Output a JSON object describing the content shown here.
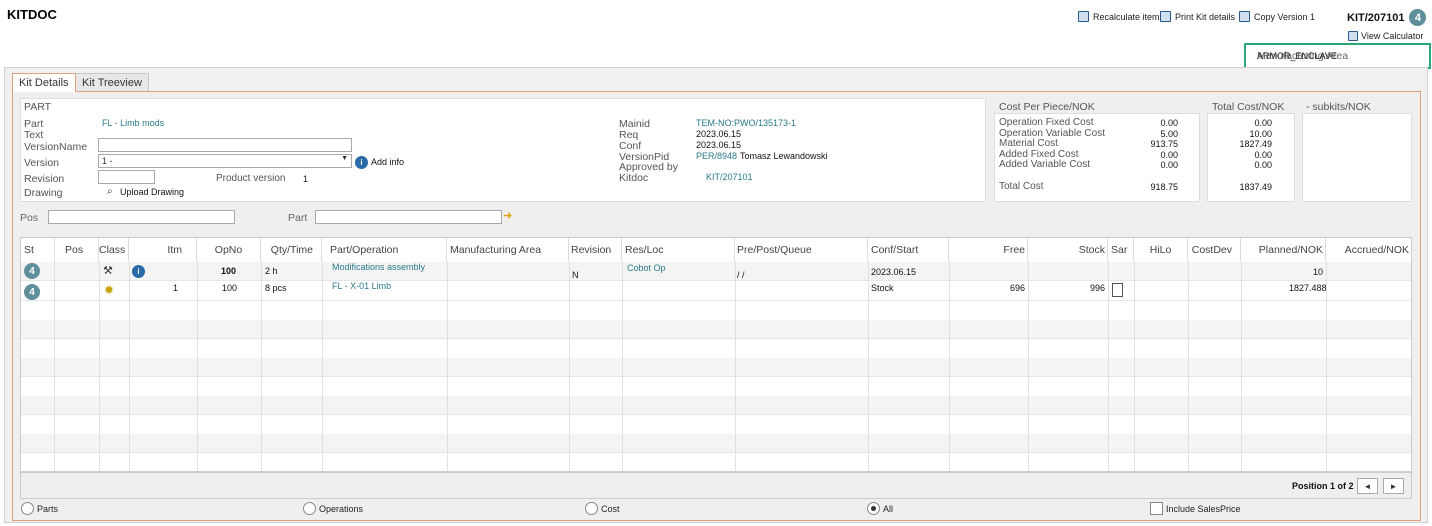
{
  "app_title": "KITDOC",
  "toolbar": {
    "recalculate": "Recalculate item",
    "print": "Print Kit details",
    "copy": "Copy Version 1",
    "kit_id": "KIT/207101",
    "kit_badge": "4",
    "view_calc": "View Calculator"
  },
  "mfg_area": {
    "label": "Manufacturing Area",
    "value": "ARMOR_ENCLAVE"
  },
  "tabs": [
    "Kit Details",
    "Kit Treeview"
  ],
  "part": {
    "header": "PART",
    "labels": {
      "part": "Part",
      "text": "Text",
      "versionname": "VersionName",
      "version": "Version",
      "revision": "Revision",
      "drawing": "Drawing"
    },
    "part_value": "FL - Limb mods",
    "version_value": "1 -",
    "add_info": "Add info",
    "product_version_label": "Product version",
    "product_version_value": "1",
    "upload_drawing": "Upload Drawing",
    "right_labels": {
      "mainid": "Mainid",
      "req": "Req",
      "conf": "Conf",
      "versionpid": "VersionPid",
      "approved": "Approved by",
      "kitdoc": "Kitdoc"
    },
    "mainid": "TEM-NO:PWO/135173-1",
    "req": "2023.06.15",
    "conf": "2023.06.15",
    "versionpid": "PER/8948",
    "versionpid_name": "Tomasz Lewandowski",
    "kitdoc": "KIT/207101"
  },
  "cost_per_piece": {
    "header": "Cost Per Piece/NOK",
    "rows": [
      {
        "label": "Operation Fixed Cost",
        "value": "0.00"
      },
      {
        "label": "Operation Variable Cost",
        "value": "5.00"
      },
      {
        "label": "Material Cost",
        "value": "913.75"
      },
      {
        "label": "Added Fixed Cost",
        "value": "0.00"
      },
      {
        "label": "Added Variable Cost",
        "value": "0.00"
      }
    ],
    "total_label": "Total Cost",
    "total_value": "918.75"
  },
  "total_cost": {
    "header": "Total Cost/NOK",
    "values": [
      "0.00",
      "10.00",
      "1827.49",
      "0.00",
      "0.00"
    ],
    "total": "1837.49"
  },
  "subkits": {
    "header": "- subkits/NOK"
  },
  "filter": {
    "pos_label": "Pos",
    "part_label": "Part"
  },
  "grid": {
    "headers": [
      "St",
      "Pos",
      "Class",
      "Itm",
      "OpNo",
      "Qty/Time",
      "Part/Operation",
      "Manufacturing Area",
      "Revision",
      "Res/Loc",
      "Pre/Post/Queue",
      "Conf/Start",
      "Free",
      "Stock",
      "Sar",
      "HiLo",
      "CostDev",
      "Planned/NOK",
      "Accrued/NOK"
    ],
    "rows": [
      {
        "st": "4",
        "itm": "",
        "opno": "100",
        "qty": "2 h",
        "part": "Modifications assembly",
        "revision": "N",
        "resloc": "Cobot Op",
        "ppq": "/ /",
        "conf": "2023.06.15",
        "free": "",
        "stock": "",
        "planned": "10"
      },
      {
        "st": "4",
        "itm": "1",
        "opno": "100",
        "qty": "8 pcs",
        "part": "FL - X-01 Limb",
        "revision": "",
        "resloc": "",
        "ppq": "",
        "conf": "Stock",
        "free": "696",
        "stock": "996",
        "planned": "1827.488"
      }
    ],
    "position_text": "Position 1 of 2"
  },
  "footer_options": {
    "parts": "Parts",
    "operations": "Operations",
    "cost": "Cost",
    "all": "All",
    "include_sales": "Include SalesPrice"
  }
}
